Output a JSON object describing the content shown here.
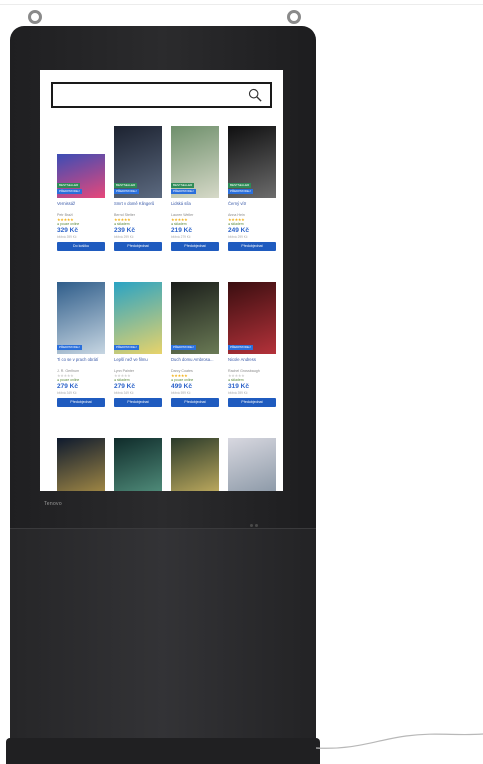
{
  "search": {
    "placeholder": ""
  },
  "device": {
    "brand": "Tenovo"
  },
  "colors": {
    "accent": "#1f5bbf",
    "bestseller": "#2e8b57",
    "preorder": "#2a6fdb",
    "star": "#f3b21b",
    "bezel": "#222224"
  },
  "rows": [
    [
      {
        "title": "Vernissáž",
        "author": "Petr Bražl",
        "stars": "★★★★★",
        "rated": true,
        "stock": "● pouze online",
        "price": "329 Kč",
        "old": "běžná 399 Kč",
        "button": "Do košíku",
        "best": "BESTSELLER",
        "pre": "PŘEDPRODEJ",
        "cover": [
          "#3b4db5",
          "#e8487a"
        ]
      },
      {
        "title": "Smrt v domě Klingerů",
        "author": "Bernd Stelter",
        "stars": "★★★★★",
        "rated": true,
        "stock": "● skladem",
        "price": "239 Kč",
        "old": "běžná 299 Kč",
        "button": "Předobjednat",
        "best": "BESTSELLER",
        "pre": "PŘEDPRODEJ",
        "cover": [
          "#1c2230",
          "#5c6a80"
        ]
      },
      {
        "title": "Lidská síla",
        "author": "Lauren Weller",
        "stars": "★★★★★",
        "rated": true,
        "stock": "● skladem",
        "price": "219 Kč",
        "old": "běžná 279 Kč",
        "button": "Předobjednat",
        "best": "BESTSELLER",
        "pre": "PŘEDPRODEJ",
        "cover": [
          "#6e8f6b",
          "#d6d9c8"
        ]
      },
      {
        "title": "Černý vítr",
        "author": "Anna Hein",
        "stars": "★★★★★",
        "rated": true,
        "stock": "● skladem",
        "price": "249 Kč",
        "old": "běžná 299 Kč",
        "button": "Předobjednat",
        "best": "BESTSELLER",
        "pre": "PŘEDPRODEJ",
        "cover": [
          "#0f0f10",
          "#6c6c6c"
        ]
      }
    ],
    [
      {
        "title": "Ti co se v prach obrátí",
        "author": "J. R. Gerlhum",
        "stars": "★★★★★",
        "rated": false,
        "stock": "● pouze online",
        "price": "279 Kč",
        "old": "běžná 349 Kč",
        "button": "Předobjednat",
        "best": "",
        "pre": "PŘEDPRODEJ",
        "cover": [
          "#2f5d8a",
          "#c7d6e2"
        ]
      },
      {
        "title": "Lepší než ve filmu",
        "author": "Lynn Painter",
        "stars": "★★★★★",
        "rated": false,
        "stock": "● skladem",
        "price": "279 Kč",
        "old": "běžná 349 Kč",
        "button": "Předobjednat",
        "best": "",
        "pre": "PŘEDPRODEJ",
        "cover": [
          "#2aa3c4",
          "#e8d36a"
        ]
      },
      {
        "title": "Duch domu Ambrosa...",
        "author": "Darcy Coates",
        "stars": "★★★★★",
        "rated": true,
        "stock": "● pouze online",
        "price": "499 Kč",
        "old": "běžná 599 Kč",
        "button": "Předobjednat",
        "best": "",
        "pre": "PŘEDPRODEJ",
        "cover": [
          "#1a1d1a",
          "#6a7a55"
        ]
      },
      {
        "title": "Nicole Andress",
        "author": "Rachel Grossbaugh",
        "stars": "★★★★★",
        "rated": false,
        "stock": "● skladem",
        "price": "319 Kč",
        "old": "běžná 399 Kč",
        "button": "Předobjednat",
        "best": "",
        "pre": "PŘEDPRODEJ",
        "cover": [
          "#3a0e10",
          "#b4323a"
        ]
      }
    ],
    [
      {
        "title": "",
        "author": "",
        "stars": "",
        "rated": false,
        "stock": "",
        "price": "",
        "old": "",
        "button": "",
        "best": "",
        "pre": "",
        "cover": [
          "#0e1a2e",
          "#c4a24a"
        ]
      },
      {
        "title": "",
        "author": "",
        "stars": "",
        "rated": false,
        "stock": "",
        "price": "",
        "old": "",
        "button": "",
        "best": "",
        "pre": "",
        "cover": [
          "#0f2b2a",
          "#5fa38d"
        ]
      },
      {
        "title": "",
        "author": "",
        "stars": "",
        "rated": false,
        "stock": "",
        "price": "",
        "old": "",
        "button": "",
        "best": "",
        "pre": "",
        "cover": [
          "#2a3a2a",
          "#e0c46a"
        ]
      },
      {
        "title": "",
        "author": "",
        "stars": "",
        "rated": false,
        "stock": "",
        "price": "",
        "old": "",
        "button": "",
        "best": "",
        "pre": "",
        "cover": [
          "#d8d8e0",
          "#7a8a9a"
        ]
      }
    ]
  ]
}
